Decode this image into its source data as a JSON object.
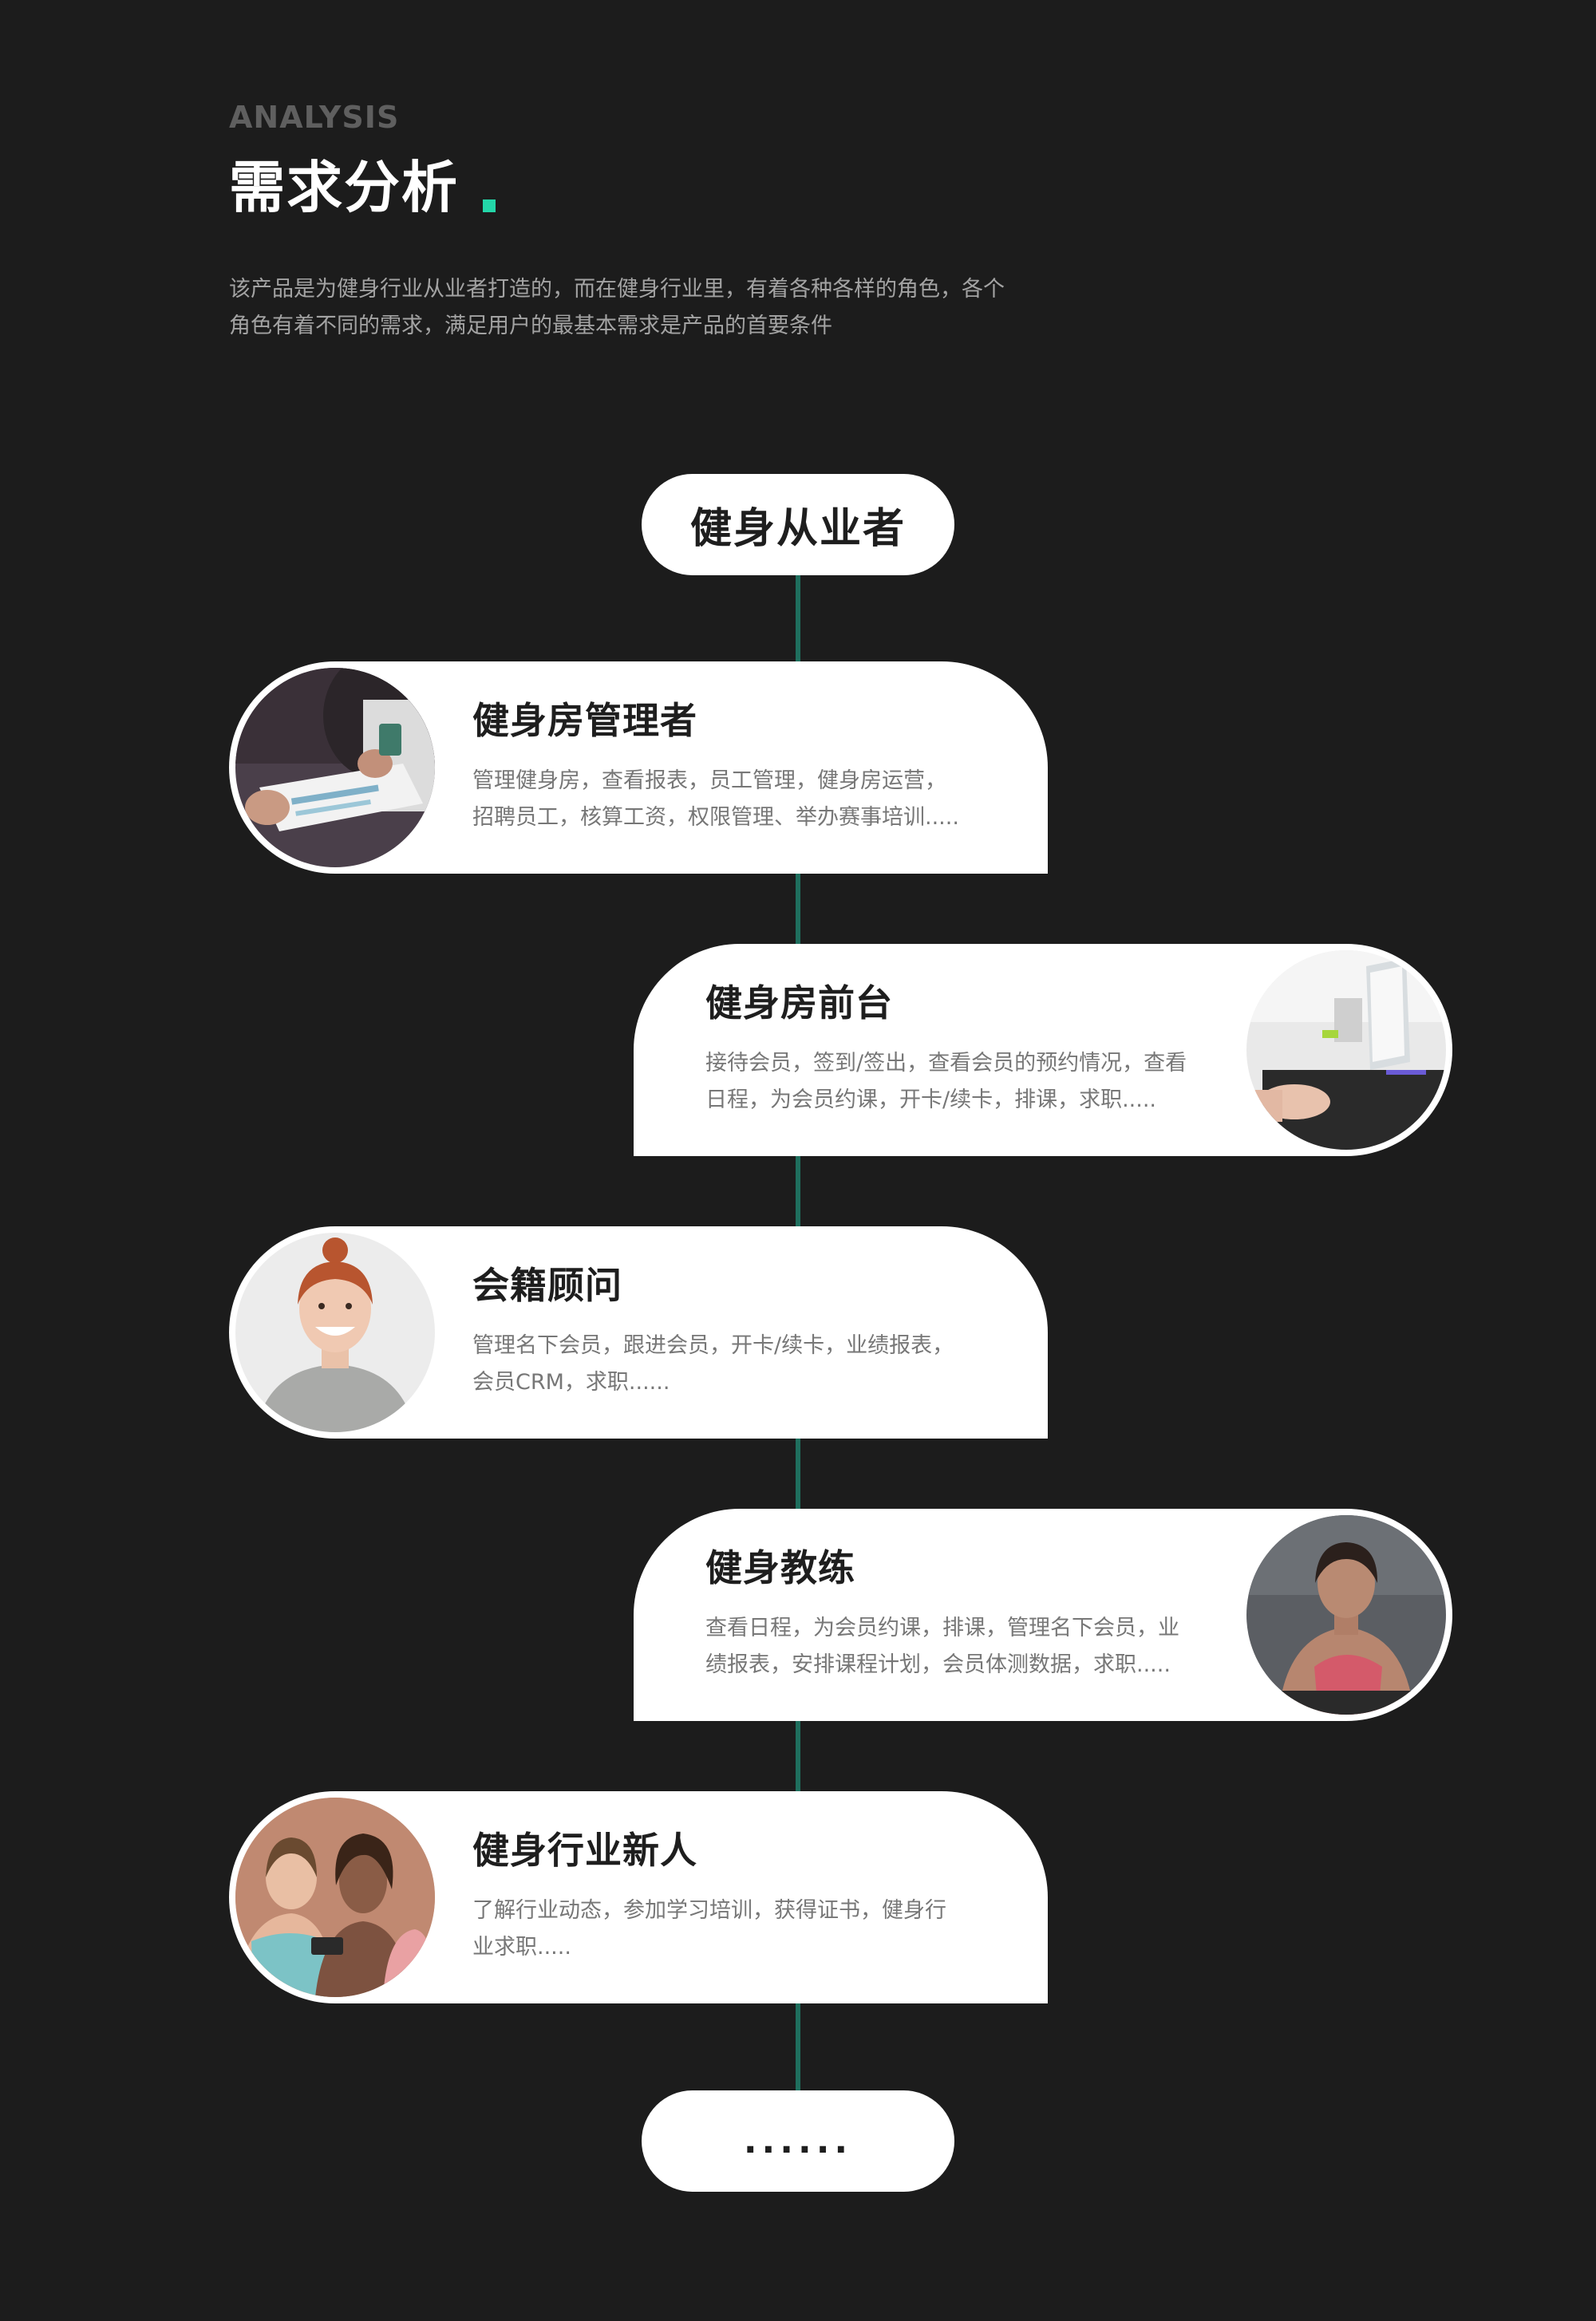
{
  "header": {
    "eyebrow": "ANALYSIS",
    "title": "需求分析",
    "intro_lines": [
      "该产品是为健身行业从业者打造的，而在健身行业里，有着各种各样的角色，各个",
      "角色有着不同的需求，满足用户的最基本需求是产品的首要条件"
    ]
  },
  "flow": {
    "top_label": "健身从业者",
    "bottom_label": "......",
    "roles": [
      {
        "title": "健身房管理者",
        "lines": [
          "管理健身房，查看报表，员工管理，健身房运营，",
          "招聘员工，核算工资，权限管理、举办赛事培训....."
        ]
      },
      {
        "title": "健身房前台",
        "lines": [
          "接待会员，签到/签出，查看会员的预约情况，查看",
          "日程，为会员约课，开卡/续卡，排课，求职....."
        ]
      },
      {
        "title": "会籍顾问",
        "lines": [
          "管理名下会员，跟进会员，开卡/续卡，业绩报表，",
          "会员CRM，求职......"
        ]
      },
      {
        "title": "健身教练",
        "lines": [
          "查看日程，为会员约课，排课，管理名下会员，业",
          "绩报表，安排课程计划，会员体测数据，求职....."
        ]
      },
      {
        "title": "健身行业新人",
        "lines": [
          "了解行业动态，参加学习培训，获得证书，健身行",
          "业求职....."
        ]
      }
    ]
  },
  "colors": {
    "background": "#1c1c1c",
    "accent": "#23d6a8",
    "connector": "#1f6f5e",
    "card": "#ffffff"
  }
}
